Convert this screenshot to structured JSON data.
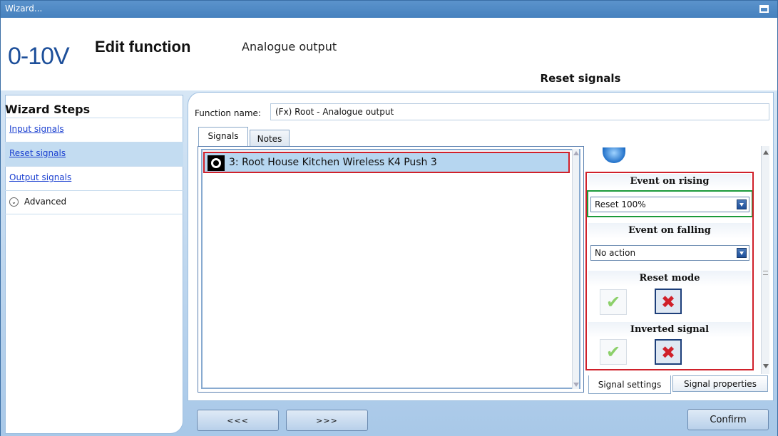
{
  "window": {
    "title": "Wizard..."
  },
  "header": {
    "logo": "0-10V",
    "title": "Edit function",
    "subtitle": "Analogue output",
    "current_step": "Reset signals"
  },
  "wizard": {
    "heading": "Wizard Steps",
    "items": [
      {
        "label": "Input signals",
        "selected": false
      },
      {
        "label": "Reset signals",
        "selected": true
      },
      {
        "label": "Output signals",
        "selected": false
      }
    ],
    "advanced_label": "Advanced"
  },
  "main": {
    "function_name_label": "Function name:",
    "function_name_value": "(Fx) Root - Analogue output",
    "tabs": [
      "Signals",
      "Notes"
    ],
    "signals": [
      {
        "label": "3: Root House Kitchen Wireless K4 Push 3",
        "selected": true
      }
    ]
  },
  "settings": {
    "event_rising_label": "Event on rising",
    "event_rising_value": "Reset 100%",
    "event_falling_label": "Event on falling",
    "event_falling_value": "No action",
    "reset_mode_label": "Reset mode",
    "reset_mode_value": false,
    "inverted_label": "Inverted signal",
    "inverted_value": false,
    "tabs": [
      "Signal settings",
      "Signal properties"
    ]
  },
  "footer": {
    "back_label": "<<<",
    "next_label": ">>>",
    "confirm_label": "Confirm"
  },
  "icons": {
    "checkmark_glyph": "✔",
    "cross_glyph": "✖",
    "chevron_glyph": "⌄"
  },
  "colors": {
    "selection_red": "#d0202a",
    "highlight_green": "#1b9a3a",
    "selected_row": "#b6d6f0",
    "link_blue": "#1a3fd0"
  }
}
